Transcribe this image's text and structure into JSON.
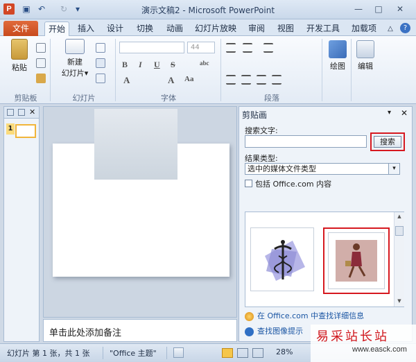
{
  "window": {
    "title": "演示文稿2 - Microsoft PowerPoint",
    "app_icon_letter": "P",
    "qat_undo": "↶",
    "qat_redo": "↻",
    "qat_save": "▣",
    "qat_more": "▾",
    "minimize": "—",
    "maximize": "□",
    "close": "✕"
  },
  "tabs": {
    "file": "文件",
    "items": [
      "开始",
      "插入",
      "设计",
      "切换",
      "动画",
      "幻灯片放映",
      "审阅",
      "视图",
      "开发工具",
      "加载项"
    ],
    "active": "开始",
    "collapse": "△",
    "help": "?"
  },
  "ribbon": {
    "clipboard": {
      "paste": "粘贴",
      "group": "剪贴板"
    },
    "slides": {
      "new_slide_1": "新建",
      "new_slide_2": "幻灯片▾",
      "group": "幻灯片"
    },
    "font": {
      "size": "44",
      "group": "字体",
      "bold": "B",
      "italic": "I",
      "underline": "U",
      "strike": "S",
      "spacing": "abc",
      "aa_up": "A",
      "aa_down": "A",
      "aa": "Aa"
    },
    "paragraph": {
      "group": "段落"
    },
    "drawing": {
      "label": "绘图"
    },
    "editing": {
      "label": "编辑"
    }
  },
  "thumbnails": {
    "slide_number": "1"
  },
  "notes": {
    "placeholder": "单击此处添加备注"
  },
  "clip_pane": {
    "title": "剪贴画",
    "search_label": "搜索文字:",
    "search_value": "",
    "search_button": "搜索",
    "result_type_label": "结果类型:",
    "result_type_value": "选中的媒体文件类型",
    "include_office_label": "包括 Office.com 内容",
    "office_link": "在 Office.com 中查找详细信息",
    "tips_link": "查找图像提示"
  },
  "statusbar": {
    "slide_info": "幻灯片 第 1 张，共 1 张",
    "theme": "\"Office 主题\"",
    "zoom": "28%"
  },
  "watermark": {
    "line1": "易采站长站",
    "line2": "www.easck.com"
  },
  "colors": {
    "accent_file_tab": "#d24726",
    "highlight_red": "#d6181f",
    "link_blue": "#1a55a3"
  }
}
